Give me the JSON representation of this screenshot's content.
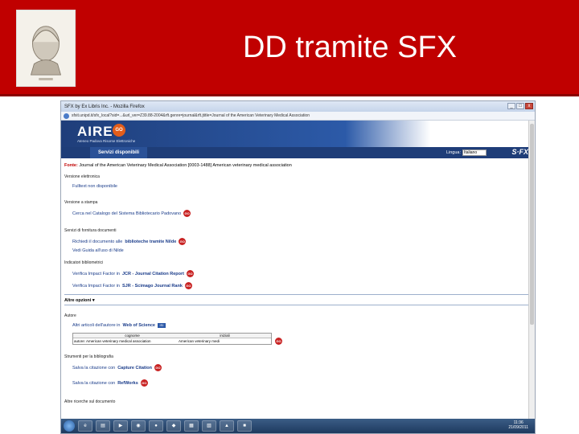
{
  "slide": {
    "title": "DD tramite SFX"
  },
  "browser": {
    "window_title": "SFX by Ex Libris Inc. - Mozilla Firefox",
    "url": "sfxit.unipd.it/sfx_local?sid=...&url_ver=Z39.88-2004&rft.genre=journal&rft.jtitle=Journal of the American Veterinary Medical Association",
    "ctrl_min": "_",
    "ctrl_max": "□",
    "ctrl_close": "x"
  },
  "portal": {
    "logo": "AIRE",
    "logo_sub": "Ateneo Padova Risorse Elettroniche",
    "go_badge": "GO",
    "servizi_tab": "Servizi disponibili",
    "lingua_label": "Lingua:",
    "lingua_value": "Italiano",
    "sfx_logo": "S·FX"
  },
  "fonte": {
    "label": "Fonte:",
    "value": "Journal of the American Veterinary Medical Association [0003-1488] American veterinary medical association"
  },
  "sections": [
    {
      "label": "Versione elettronica",
      "link_prefix": "Fulltext non disponibile",
      "link_bold": "",
      "has_go": false
    },
    {
      "label": "Versione a stampa",
      "link_prefix": "Cerca nel Catalogo del Sistema Bibliotecario Padovano",
      "link_bold": "",
      "has_go": true
    },
    {
      "label": "Servizi di fornitura documenti",
      "link_prefix": "Richiedi il documento alle",
      "link_bold": "biblioteche tramite Nilde",
      "has_go": true
    }
  ],
  "nilde_note": "Vedi Guida all'uso di Nilde",
  "indicatori": {
    "label": "Indicatori bibliometrici",
    "jcr_prefix": "Verifica Impact Factor in",
    "jcr_bold": "JCR - Journal Citation Report",
    "sjr_prefix": "Verifica Impact Factor in",
    "sjr_bold": "SJR - Scimago Journal Rank"
  },
  "altre_opzioni": "Altre opzioni ▾",
  "autore": {
    "label": "Autore",
    "link_prefix": "Altri articoli dell'autore in",
    "link_bold": "Web of Science",
    "badge": "ISI",
    "col_cognome": "cognome",
    "col_iniziali": "iniziali",
    "row_label": "autore:",
    "row_cognome": "American veterinary medical association",
    "row_iniziali": "American veterinary medi"
  },
  "bibliografia": {
    "label": "Strumenti per la bibliografia",
    "capture_prefix": "Salva la citazione con",
    "capture_bold": "Capture Citation",
    "refworks_prefix": "Salva la citazione con",
    "refworks_bold": "RefWorks"
  },
  "more_label": "Altre ricerche sul documento",
  "go_label": "GO",
  "taskbar": {
    "time": "11:36",
    "date": "21/09/2011"
  },
  "colors": {
    "slide_red": "#c00000",
    "portal_blue": "#1e3d78",
    "link_blue": "#1a3c8a"
  }
}
